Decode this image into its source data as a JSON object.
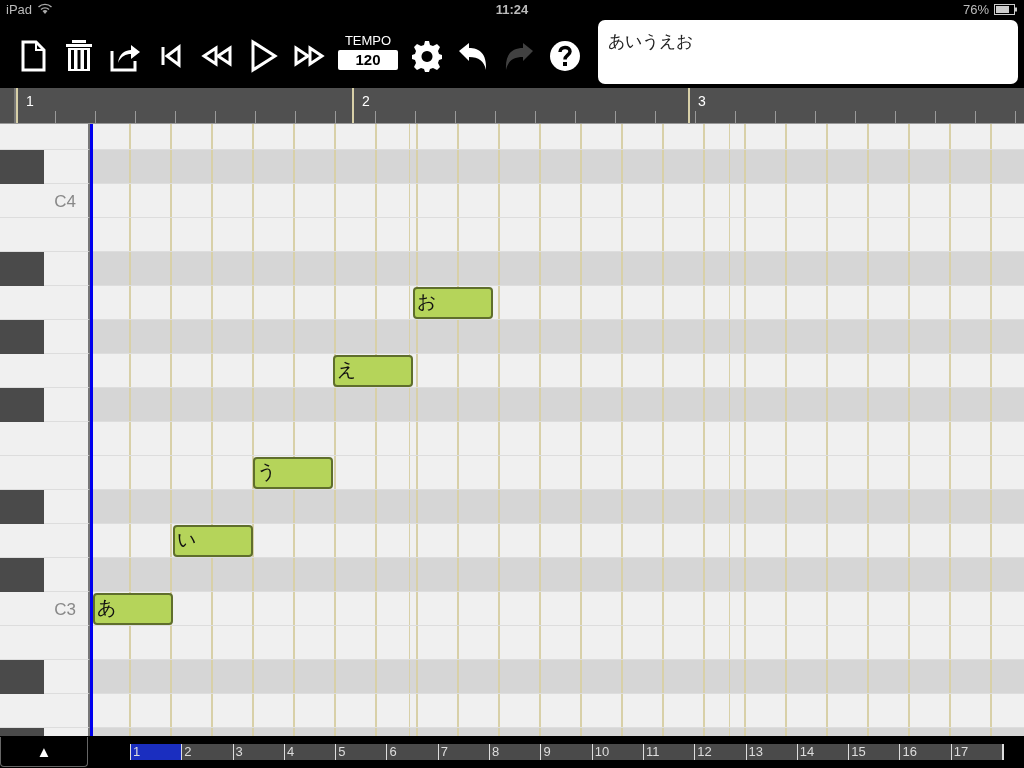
{
  "status_bar": {
    "device": "iPad",
    "time": "11:24",
    "battery": "76%"
  },
  "toolbar": {
    "buttons": [
      {
        "kind": "new",
        "disabled": false
      },
      {
        "kind": "trash",
        "disabled": false
      },
      {
        "kind": "share",
        "disabled": false
      },
      {
        "kind": "skip-back",
        "disabled": false
      },
      {
        "kind": "rewind",
        "disabled": false
      },
      {
        "kind": "play",
        "disabled": false
      },
      {
        "kind": "fast-forward",
        "disabled": false
      },
      {
        "kind": "tempo"
      },
      {
        "kind": "settings",
        "disabled": false
      },
      {
        "kind": "undo",
        "disabled": false
      },
      {
        "kind": "redo",
        "disabled": true
      },
      {
        "kind": "help",
        "disabled": false
      }
    ],
    "tempo": {
      "label": "TEMPO",
      "value": "120"
    },
    "lyrics": {
      "value": "あいうえお"
    }
  },
  "ruler": {
    "measures": [
      "1",
      "2",
      "3"
    ]
  },
  "keys": [
    {
      "black": false
    },
    {
      "black": true
    },
    {
      "black": false,
      "label": "C4"
    },
    {
      "black": false
    },
    {
      "black": true
    },
    {
      "black": false,
      "notes": [
        {
          "lyric": "お"
        }
      ]
    },
    {
      "black": true
    },
    {
      "black": false,
      "notes": [
        {
          "lyric": "え"
        }
      ]
    },
    {
      "black": true
    },
    {
      "black": false
    },
    {
      "black": false,
      "notes": [
        {
          "lyric": "う"
        }
      ]
    },
    {
      "black": true
    },
    {
      "black": false,
      "notes": [
        {
          "lyric": "い"
        }
      ]
    },
    {
      "black": true
    },
    {
      "black": false,
      "label": "C3",
      "notes": [
        {
          "lyric": "あ"
        }
      ]
    },
    {
      "black": false
    },
    {
      "black": true
    },
    {
      "black": false
    },
    {
      "black": true
    }
  ],
  "bottom_bar": {
    "toggle": "▲",
    "measures": [
      {
        "label": "1",
        "selected": true
      },
      {
        "label": "2",
        "selected": false
      },
      {
        "label": "3",
        "selected": false
      },
      {
        "label": "4",
        "selected": false
      },
      {
        "label": "5",
        "selected": false
      },
      {
        "label": "6",
        "selected": false
      },
      {
        "label": "7",
        "selected": false
      },
      {
        "label": "8",
        "selected": false
      },
      {
        "label": "9",
        "selected": false
      },
      {
        "label": "10",
        "selected": false
      },
      {
        "label": "11",
        "selected": false
      },
      {
        "label": "12",
        "selected": false
      },
      {
        "label": "13",
        "selected": false
      },
      {
        "label": "14",
        "selected": false
      },
      {
        "label": "15",
        "selected": false
      },
      {
        "label": "16",
        "selected": false
      },
      {
        "label": "17",
        "selected": false
      }
    ]
  }
}
